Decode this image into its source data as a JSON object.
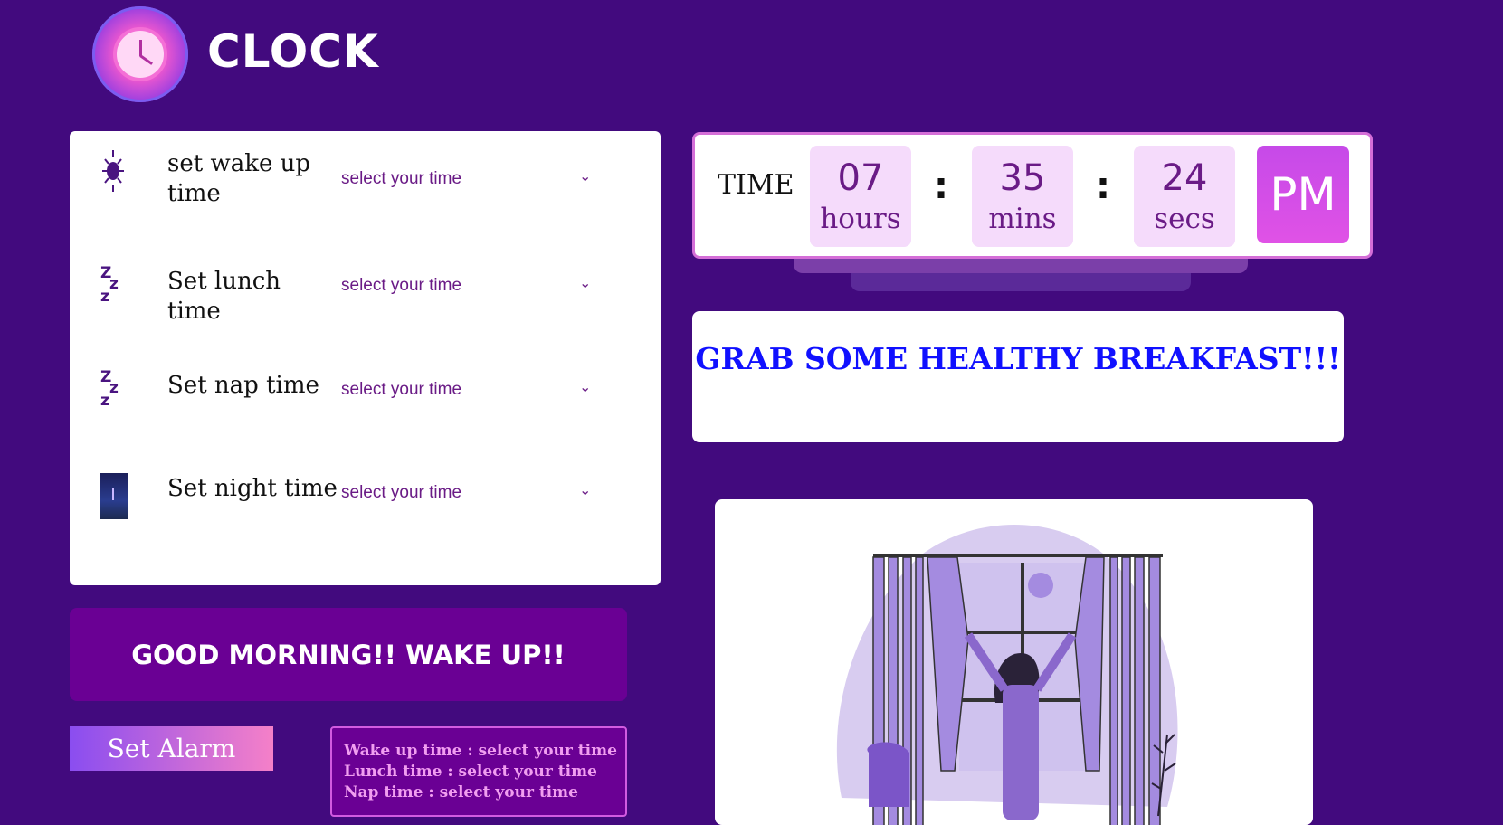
{
  "header": {
    "logo_icon": "clock-icon",
    "brand": "CLOCK"
  },
  "settings": {
    "rows": [
      {
        "icon": "sun-icon",
        "label": "set wake up time",
        "select": "select your time"
      },
      {
        "icon": "zzz-icon",
        "label": "Set lunch time",
        "select": "select your time"
      },
      {
        "icon": "zzz-icon",
        "label": "Set nap time",
        "select": "select your time"
      },
      {
        "icon": "night-icon",
        "label": "Set night time",
        "select": "select your time"
      }
    ]
  },
  "greeting": "GOOD MORNING!! WAKE UP!!",
  "alarm_button": "Set Alarm",
  "summary": {
    "lines": [
      "Wake up time : select your time",
      "Lunch time : select your time",
      "Nap time : select your time"
    ]
  },
  "time": {
    "label": "TIME",
    "hours": "07",
    "hours_unit": "hours",
    "mins": "35",
    "mins_unit": "mins",
    "secs": "24",
    "secs_unit": "secs",
    "separator": ":",
    "ampm": "PM"
  },
  "message": "GRAB SOME HEALTHY BREAKFAST!!!",
  "illustration": {
    "icon": "woman-opening-curtains-illustration"
  },
  "colors": {
    "background": "#420a7e",
    "accent": "#6a0094",
    "message_text": "#1010ff"
  }
}
